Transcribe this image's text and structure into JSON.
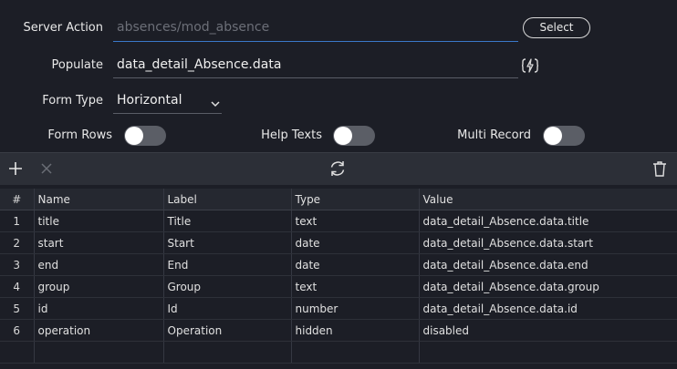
{
  "form": {
    "server_action": {
      "label": "Server Action",
      "placeholder": "absences/mod_absence",
      "button_label": "Select"
    },
    "populate": {
      "label": "Populate",
      "value": "data_detail_Absence.data"
    },
    "form_type": {
      "label": "Form Type",
      "value": "Horizontal"
    },
    "toggles": [
      {
        "label": "Form Rows",
        "on": false
      },
      {
        "label": "Help Texts",
        "on": false
      },
      {
        "label": "Multi Record",
        "on": false
      }
    ]
  },
  "toolbar": {
    "add_icon": "plus-icon",
    "remove_icon": "close-icon",
    "refresh_icon": "refresh-icon",
    "delete_icon": "trash-icon"
  },
  "table": {
    "headers": [
      "#",
      "Name",
      "Label",
      "Type",
      "Value"
    ],
    "rows": [
      [
        "1",
        "title",
        "Title",
        "text",
        "data_detail_Absence.data.title"
      ],
      [
        "2",
        "start",
        "Start",
        "date",
        "data_detail_Absence.data.start"
      ],
      [
        "3",
        "end",
        "End",
        "date",
        "data_detail_Absence.data.end"
      ],
      [
        "4",
        "group",
        "Group",
        "text",
        "data_detail_Absence.data.group"
      ],
      [
        "5",
        "id",
        "Id",
        "number",
        "data_detail_Absence.data.id"
      ],
      [
        "6",
        "operation",
        "Operation",
        "hidden",
        "disabled"
      ]
    ]
  },
  "colors": {
    "background": "#1c1e26",
    "input_focus_underline": "#3a78c8",
    "toggle_track": "#5b5e66"
  }
}
